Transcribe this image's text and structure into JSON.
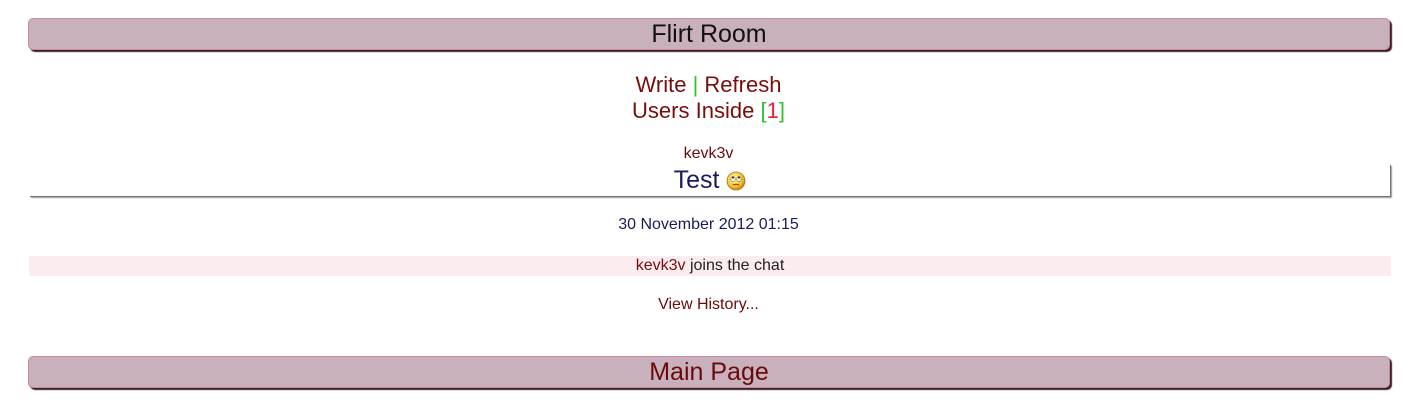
{
  "room": {
    "title": "Flirt Room"
  },
  "nav": {
    "write_label": "Write",
    "separator": "|",
    "refresh_label": "Refresh",
    "users_inside_label": "Users Inside",
    "bracket_open": "[",
    "users_count": "1",
    "bracket_close": "]"
  },
  "messages": [
    {
      "author": "kevk3v",
      "text": "Test",
      "icon": "rolling-eyes-smiley-icon",
      "timestamp": "30 November 2012 01:15"
    }
  ],
  "events": [
    {
      "user": "kevk3v",
      "action": " joins the chat"
    }
  ],
  "history_link": "View History...",
  "footer": {
    "main_page_label": "Main Page"
  },
  "colors": {
    "bar_bg": "#c8b0bd",
    "link": "#7a0c0c",
    "accent_green": "#32c032",
    "count_red": "#e0243a",
    "message_text": "#1a1a5e",
    "event_row_bg": "#fbecf0"
  }
}
